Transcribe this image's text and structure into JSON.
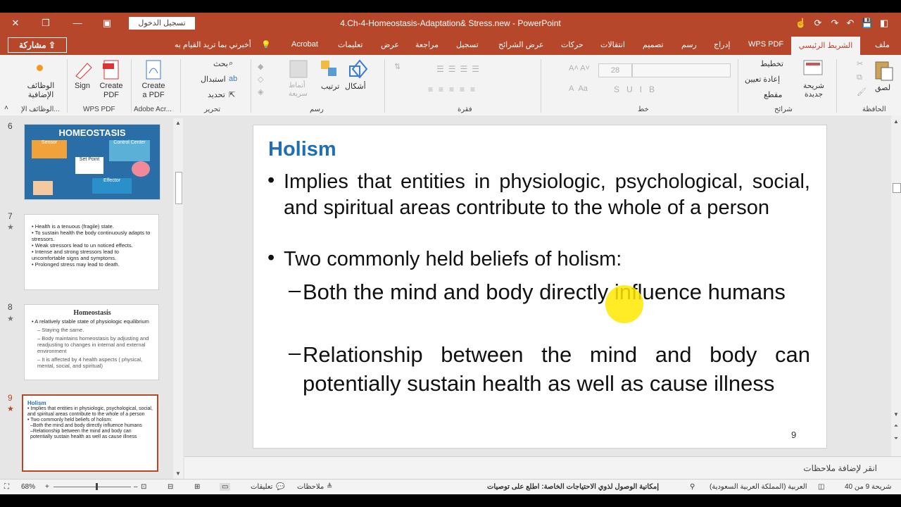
{
  "window": {
    "title": "4.Ch-4-Homeostasis-Adaptation& Stress.new  -  PowerPoint",
    "signin": "تسجيل الدخول",
    "share": "مشاركة"
  },
  "tabs": {
    "file": "ملف",
    "home": "الشريط الرئيسي",
    "wps_pdf": "WPS PDF",
    "insert": "إدراج",
    "draw": "رسم",
    "design": "تصميم",
    "transitions": "انتقالات",
    "animations": "حركات",
    "slideshow": "عرض الشرائح",
    "record": "تسجيل",
    "review": "مراجعة",
    "view": "عرض",
    "help": "تعليمات",
    "acrobat": "Acrobat",
    "tellme": "أخبرني بما تريد القيام به"
  },
  "ribbon": {
    "clipboard": {
      "paste": "لصق",
      "group": "الحافظة"
    },
    "slides": {
      "new_slide": "شريحة جديدة",
      "layout": "تخطيط",
      "reset": "إعادة تعيين",
      "section": "مقطع",
      "group": "شرائح"
    },
    "font": {
      "size": "28",
      "group": "خط"
    },
    "paragraph": {
      "group": "فقرة"
    },
    "drawing": {
      "shapes": "أشكال",
      "arrange": "ترتيب",
      "quick_styles": "أنماط سريعة",
      "group": "رسم"
    },
    "editing": {
      "find": "بحث",
      "replace": "استبدال",
      "select": "تحديد",
      "group": "تحرير"
    },
    "adobe": {
      "create": "Create a PDF",
      "group": "Adobe Acr..."
    },
    "wps": {
      "create": "Create PDF",
      "sign": "Sign",
      "group": "WPS PDF"
    },
    "addins": {
      "label": "الوظائف الإضافية",
      "group": "الوظائف الإ..."
    }
  },
  "thumbnails": [
    {
      "num": "6",
      "title": "HOMEOSTASIS",
      "labels": [
        "Sensor",
        "Control Center",
        "Set Point",
        "Effector"
      ]
    },
    {
      "num": "7",
      "star": "★",
      "lines": [
        "• Health is a tenuous (fragile) state.",
        "• To sustain health the body continuously adapts to stressors.",
        "• Weak stressors lead to un noticed effects.",
        "• Intense and strong stressors lead to uncomfortable signs and symptoms.",
        "• Prolonged stress may lead to death."
      ]
    },
    {
      "num": "8",
      "star": "★",
      "title": "Homeostasis",
      "lines": [
        "• A relatively stable state of physiologic equilibrium",
        "– Staying the same.",
        "– Body maintains homeostasis by adjusting and readjusting to changes in internal and external environment",
        "– It is affected by 4 health aspects ( physical, mental, social, and spiritual)"
      ]
    },
    {
      "num": "9",
      "title": "Holism",
      "lines": [
        "• Implies that entities in physiologic, psychological, social, and spiritual areas contribute to the whole of a person",
        "• Two commonly held beliefs of holism:",
        "–Both the mind and body directly influence humans",
        "–Relationship between the mind and body can potentially sustain health as well as cause illness"
      ]
    }
  ],
  "slide": {
    "title": "Holism",
    "bullets": [
      "Implies that entities in physiologic, psychological, social, and spiritual areas contribute to the whole of a person",
      "Two commonly held beliefs of holism:"
    ],
    "subbullets": [
      "Both the mind and body directly influence humans",
      "Relationship between the mind and body can potentially sustain health as well as cause illness"
    ],
    "page_number": "9"
  },
  "notes_placeholder": "انقر لإضافة ملاحظات",
  "status": {
    "slide_info": "شريحة 9 من 40",
    "language": "العربية (المملكة العربية السعودية)",
    "accessibility": "إمكانية الوصول لذوي الاحتياجات الخاصة: اطلع على توصيات",
    "notes": "ملاحظات",
    "comments": "تعليقات",
    "zoom": "68%"
  }
}
